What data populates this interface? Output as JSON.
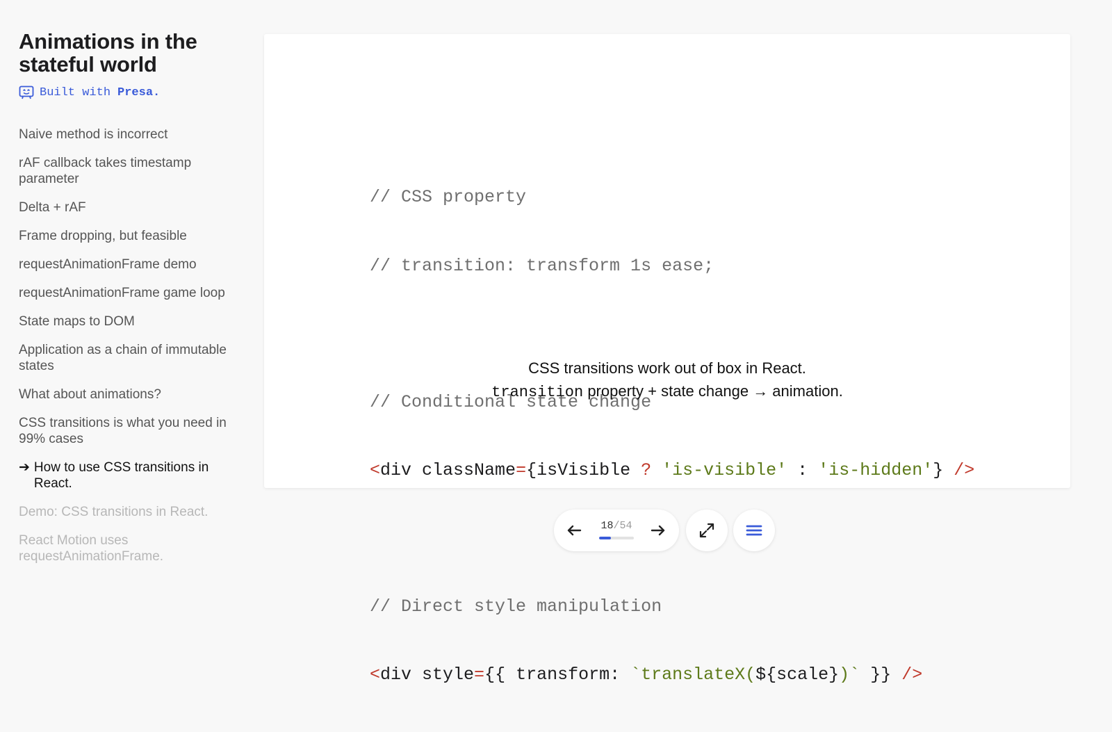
{
  "deck": {
    "title": "Animations in the stateful world",
    "built_with_prefix": "Built with",
    "built_with_brand": "Presa."
  },
  "toc": {
    "items": [
      {
        "label": "Naive method is incorrect",
        "state": "past"
      },
      {
        "label": "rAF callback takes timestamp parameter",
        "state": "past"
      },
      {
        "label": "Delta + rAF",
        "state": "past"
      },
      {
        "label": "Frame dropping, but feasible",
        "state": "past"
      },
      {
        "label": "requestAnimationFrame demo",
        "state": "past"
      },
      {
        "label": "requestAnimationFrame game loop",
        "state": "past"
      },
      {
        "label": "State maps to DOM",
        "state": "past"
      },
      {
        "label": "Application as a chain of immutable states",
        "state": "past"
      },
      {
        "label": "What about animations?",
        "state": "past"
      },
      {
        "label": "CSS transitions is what you need in 99% cases",
        "state": "past"
      },
      {
        "label": "How to use CSS transitions in React.",
        "state": "current"
      },
      {
        "label": "Demo: CSS transitions in React.",
        "state": "future"
      },
      {
        "label": "React Motion uses requestAnimationFrame.",
        "state": "future"
      }
    ],
    "current_marker": "➔"
  },
  "slide": {
    "code": {
      "c1": "// CSS property",
      "c2": "// transition: transform 1s ease;",
      "c3": "// Conditional state change",
      "l4_tag_open": "<",
      "l4_a": "div className",
      "l4_eq": "=",
      "l4_b": "{isVisible ",
      "l4_q": "?",
      "l4_s1": "'is-visible'",
      "l4_c": " : ",
      "l4_s2": "'is-hidden'",
      "l4_d": "} ",
      "l4_close": "/>",
      "c5": "// Direct style manipulation",
      "l6_tag_open": "<",
      "l6_a": "div style",
      "l6_eq": "=",
      "l6_b": "{{ transform: ",
      "l6_s1": "`translateX(",
      "l6_interp": "${scale}",
      "l6_s2": ")`",
      "l6_c": " }} ",
      "l6_close": "/>"
    },
    "caption_line1": "CSS transitions work out of box in React.",
    "caption_code": "transition",
    "caption_line2_rest": " property + state change → animation."
  },
  "controls": {
    "current_page": "18",
    "separator": "/",
    "total_pages": "54",
    "progress_fraction": 0.333
  },
  "colors": {
    "accent": "#3a5bd9",
    "code_comment": "#6f6f6f",
    "code_tag": "#c0392b",
    "code_string": "#5d7a1a"
  },
  "icons": {
    "brand": "presa-logo-icon",
    "prev": "arrow-left-icon",
    "next": "arrow-right-icon",
    "fullscreen": "expand-icon",
    "menu": "menu-icon"
  }
}
